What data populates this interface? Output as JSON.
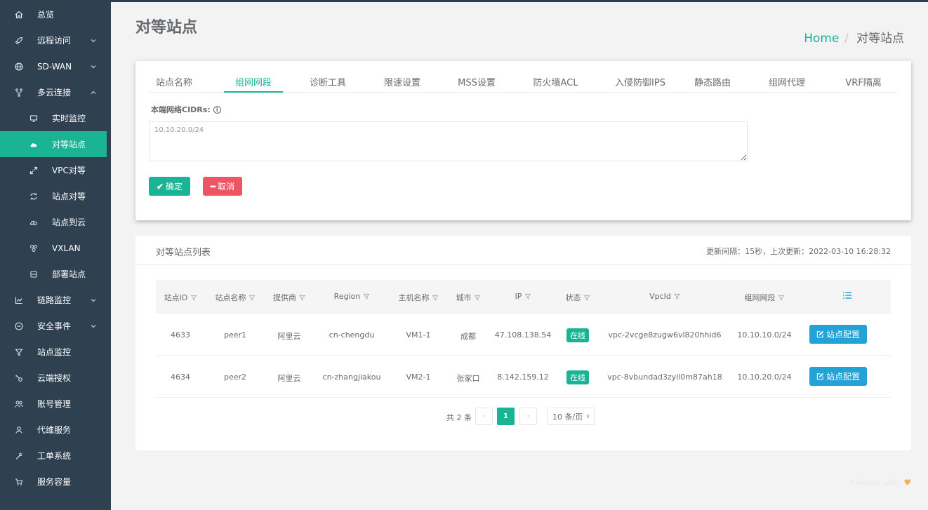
{
  "sidebar": {
    "items": [
      {
        "label": "总览",
        "icon": "home-icon"
      },
      {
        "label": "远程访问",
        "icon": "rocket-icon",
        "expandable": true
      },
      {
        "label": "SD-WAN",
        "icon": "globe-icon",
        "expandable": true
      },
      {
        "label": "多云连接",
        "icon": "fork-icon",
        "expandable": true,
        "expanded": true
      },
      {
        "label": "实时监控",
        "icon": "monitor-icon",
        "sub": true
      },
      {
        "label": "对等站点",
        "icon": "cloud-icon",
        "sub": true,
        "active": true
      },
      {
        "label": "VPC对等",
        "icon": "expand-icon",
        "sub": true
      },
      {
        "label": "站点对等",
        "icon": "exchange-icon",
        "sub": true
      },
      {
        "label": "站点到云",
        "icon": "cloud-upload-icon",
        "sub": true
      },
      {
        "label": "VXLAN",
        "icon": "network-icon",
        "sub": true
      },
      {
        "label": "部署站点",
        "icon": "server-icon",
        "sub": true
      },
      {
        "label": "链路监控",
        "icon": "line-chart-icon",
        "expandable": true
      },
      {
        "label": "安全事件",
        "icon": "minus-circle-icon",
        "expandable": true
      },
      {
        "label": "站点监控",
        "icon": "filter-icon"
      },
      {
        "label": "云端授权",
        "icon": "key-icon"
      },
      {
        "label": "账号管理",
        "icon": "users-icon"
      },
      {
        "label": "代维服务",
        "icon": "user-icon"
      },
      {
        "label": "工单系统",
        "icon": "wrench-icon"
      },
      {
        "label": "服务容量",
        "icon": "cart-icon"
      }
    ]
  },
  "header": {
    "title": "对等站点",
    "breadcrumb_home": "Home",
    "breadcrumb_sep": "/",
    "breadcrumb_current": "对等站点"
  },
  "form": {
    "tabs": [
      "站点名称",
      "组网网段",
      "诊断工具",
      "限速设置",
      "MSS设置",
      "防火墙ACL",
      "入侵防御IPS",
      "静态路由",
      "组网代理",
      "VRF隔离"
    ],
    "active_tab": "组网网段",
    "cidr_label": "本端网络CIDRs:",
    "cidr_value": "10.10.20.0/24",
    "confirm_label": "确定",
    "cancel_label": "取消"
  },
  "list": {
    "title": "对等站点列表",
    "refresh_info": "更新间隔：15秒，上次更新：2022-03-10 16:28:32",
    "columns": [
      "站点ID",
      "站点名称",
      "提供商",
      "Region",
      "主机名称",
      "城市",
      "IP",
      "状态",
      "VpcId",
      "组网网段"
    ],
    "rows": [
      {
        "id": "4633",
        "name": "peer1",
        "provider": "阿里云",
        "region": "cn-chengdu",
        "host": "VM1-1",
        "city": "成都",
        "ip": "47.108.138.54",
        "status": "在线",
        "vpc": "vpc-2vcge8zugw6vl820hhid6",
        "cidr": "10.10.10.0/24",
        "action": "站点配置"
      },
      {
        "id": "4634",
        "name": "peer2",
        "provider": "阿里云",
        "region": "cn-zhangjiakou",
        "host": "VM2-1",
        "city": "张家口",
        "ip": "8.142.159.12",
        "status": "在线",
        "vpc": "vpc-8vbundad3zyll0m87ah18",
        "cidr": "10.10.20.0/24",
        "action": "站点配置"
      }
    ],
    "pagination": {
      "total": "共 2 条",
      "prev": "‹",
      "current": "1",
      "next": "›",
      "page_size": "10 条/页"
    }
  },
  "footer": {
    "text": "Created with",
    "heart": "♥"
  },
  "colors": {
    "sidebar_bg": "#2f4050",
    "accent": "#1ab394",
    "danger": "#ed5565",
    "info": "#23a2d6"
  }
}
